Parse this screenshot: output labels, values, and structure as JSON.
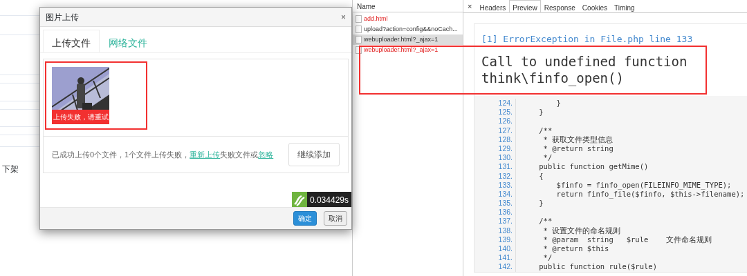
{
  "background_page": {
    "row_label": "下架"
  },
  "dialog": {
    "title": "图片上传",
    "close": "×",
    "tabs": [
      {
        "label": "上传文件",
        "selected": true
      },
      {
        "label": "网络文件",
        "selected": false
      }
    ],
    "files": [
      {
        "kind": "picture",
        "error": "上传失败，请重试",
        "highlighted": true
      }
    ],
    "status_parts": [
      {
        "kind": "text",
        "text": "已成功上传0个文件，1个文件上传失败，"
      },
      {
        "kind": "link",
        "text": "重新上传"
      },
      {
        "kind": "text",
        "text": "失败文件或"
      },
      {
        "kind": "link",
        "text": "忽略"
      }
    ],
    "add_button": "继续添加",
    "debug_time": "0.034429s",
    "buttons": [
      {
        "label": "确定",
        "primary": true
      },
      {
        "label": "取消",
        "primary": false
      }
    ]
  },
  "network": {
    "column": "Name",
    "requests": [
      {
        "name": "add.html",
        "failed": true,
        "selected": false
      },
      {
        "name": "upload?action=config&&noCach...",
        "failed": false,
        "selected": false
      },
      {
        "name": "webuploader.html?_ajax=1",
        "failed": false,
        "selected": true
      },
      {
        "name": "webuploader.html?_ajax=1",
        "failed": true,
        "selected": false
      }
    ]
  },
  "preview": {
    "close": "×",
    "tabs": [
      {
        "label": "Headers",
        "selected": false
      },
      {
        "label": "Preview",
        "selected": true
      },
      {
        "label": "Response",
        "selected": false
      },
      {
        "label": "Cookies",
        "selected": false
      },
      {
        "label": "Timing",
        "selected": false
      }
    ],
    "error_heading": "[1] ErrorException in File.php line 133",
    "message_lines": [
      "Call to undefined function",
      "think\\finfo_open()"
    ],
    "highlighted": true,
    "code": [
      {
        "number": "124.",
        "text": "        }"
      },
      {
        "number": "125.",
        "text": "    }"
      },
      {
        "number": "126."
      },
      {
        "number": "127.",
        "text": "    /**"
      },
      {
        "number": "128.",
        "text": "     * 获取文件类型信息"
      },
      {
        "number": "129.",
        "text": "     * @return string"
      },
      {
        "number": "130.",
        "text": "     */"
      },
      {
        "number": "131.",
        "text": "    public function getMime()"
      },
      {
        "number": "132.",
        "text": "    {"
      },
      {
        "number": "133.",
        "text": "        $finfo = finfo_open(FILEINFO_MIME_TYPE);"
      },
      {
        "number": "134.",
        "text": "        return finfo_file($finfo, $this->filename);"
      },
      {
        "number": "135.",
        "text": "    }"
      },
      {
        "number": "136."
      },
      {
        "number": "137.",
        "text": "    /**"
      },
      {
        "number": "138.",
        "text": "     * 设置文件的命名规则"
      },
      {
        "number": "139.",
        "text": "     * @param  string   $rule    文件命名规则"
      },
      {
        "number": "140.",
        "text": "     * @return $this"
      },
      {
        "number": "141.",
        "text": "     */"
      },
      {
        "number": "142.",
        "text": "    public function rule($rule)"
      }
    ]
  }
}
